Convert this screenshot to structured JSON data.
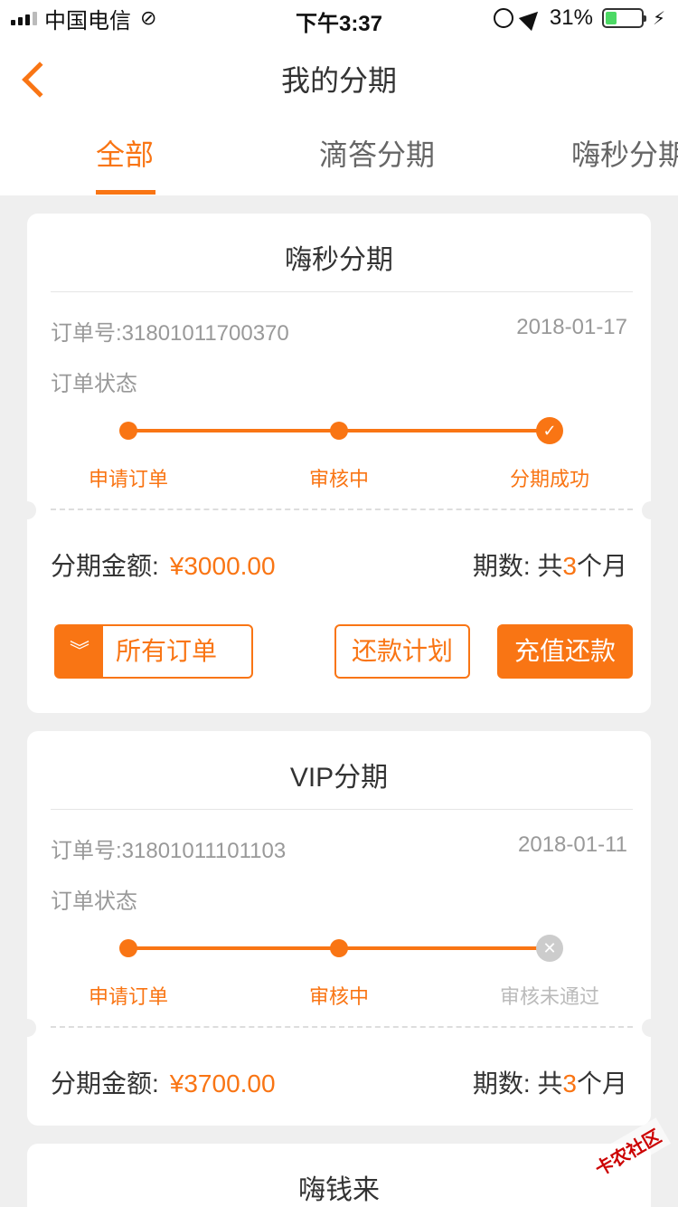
{
  "status_bar": {
    "carrier": "中国电信",
    "time": "下午3:37",
    "battery": "31%",
    "battery_level": 0.31
  },
  "header": {
    "title": "我的分期"
  },
  "tabs": [
    {
      "label": "全部",
      "active": true
    },
    {
      "label": "滴答分期",
      "active": false
    },
    {
      "label": "嗨秒分期",
      "active": false
    }
  ],
  "orders": [
    {
      "product": "嗨秒分期",
      "order_no": "订单号:31801011700370",
      "date": "2018-01-17",
      "status_label": "订单状态",
      "steps": [
        "申请订单",
        "审核中",
        "分期成功"
      ],
      "final_step_status": "success",
      "amount_label": "分期金额:",
      "amount": "¥3000.00",
      "periods_label": "期数:",
      "periods_prefix": "共",
      "periods_num": "3",
      "periods_suffix": "个月",
      "buttons": {
        "all_orders": "所有订单",
        "repay_plan": "还款计划",
        "recharge_repay": "充值还款"
      }
    },
    {
      "product": "VIP分期",
      "order_no": "订单号:31801011101103",
      "date": "2018-01-11",
      "status_label": "订单状态",
      "steps": [
        "申请订单",
        "审核中",
        "审核未通过"
      ],
      "final_step_status": "failed",
      "amount_label": "分期金额:",
      "amount": "¥3700.00",
      "periods_label": "期数:",
      "periods_prefix": "共",
      "periods_num": "3",
      "periods_suffix": "个月"
    },
    {
      "product": "嗨钱来"
    }
  ],
  "watermark": "卡农社区",
  "colors": {
    "accent": "#f97514",
    "background": "#efefef",
    "muted": "#999999"
  }
}
